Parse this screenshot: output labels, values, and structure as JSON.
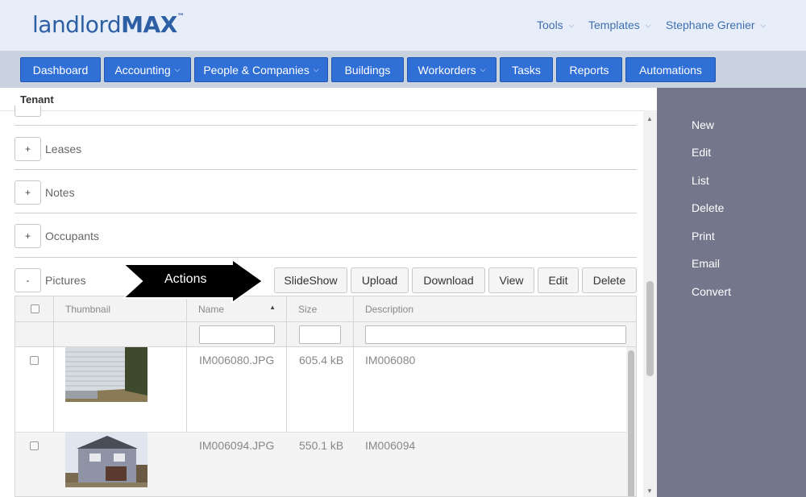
{
  "app": {
    "logo_light": "landlord",
    "logo_bold": "MAX",
    "logo_tm": "™"
  },
  "topnav": {
    "tools": "Tools",
    "templates": "Templates",
    "user": "Stephane Grenier"
  },
  "navbar": [
    {
      "label": "Dashboard",
      "dropdown": false
    },
    {
      "label": "Accounting",
      "dropdown": true
    },
    {
      "label": "People & Companies",
      "dropdown": true
    },
    {
      "label": "Buildings",
      "dropdown": false
    },
    {
      "label": "Workorders",
      "dropdown": true
    },
    {
      "label": "Tasks",
      "dropdown": false
    },
    {
      "label": "Reports",
      "dropdown": false
    },
    {
      "label": "Automations",
      "dropdown": false
    }
  ],
  "page": {
    "title": "Tenant"
  },
  "sections": {
    "leases": {
      "label": "Leases",
      "toggle": "+"
    },
    "notes": {
      "label": "Notes",
      "toggle": "+"
    },
    "occupants": {
      "label": "Occupants",
      "toggle": "+"
    },
    "pictures": {
      "label": "Pictures",
      "toggle": "-"
    }
  },
  "callout": {
    "text": "Actions"
  },
  "actions": {
    "slideshow": "SlideShow",
    "upload": "Upload",
    "download": "Download",
    "view": "View",
    "edit": "Edit",
    "delete": "Delete"
  },
  "table": {
    "columns": {
      "thumbnail": "Thumbnail",
      "name": "Name",
      "size": "Size",
      "description": "Description"
    },
    "rows": [
      {
        "name": "IM006080.JPG",
        "size": "605.4 kB",
        "description": "IM006080"
      },
      {
        "name": "IM006094.JPG",
        "size": "550.1 kB",
        "description": "IM006094"
      }
    ]
  },
  "sidepanel": {
    "new": "New",
    "edit": "Edit",
    "list": "List",
    "delete": "Delete",
    "print": "Print",
    "email": "Email",
    "convert": "Convert"
  },
  "colors": {
    "nav_button": "#2f6fd6",
    "header_bg": "#e8eef9",
    "navbar_bg": "#c9d3e0",
    "side_panel": "#74778c",
    "logo": "#2c5fa3"
  }
}
